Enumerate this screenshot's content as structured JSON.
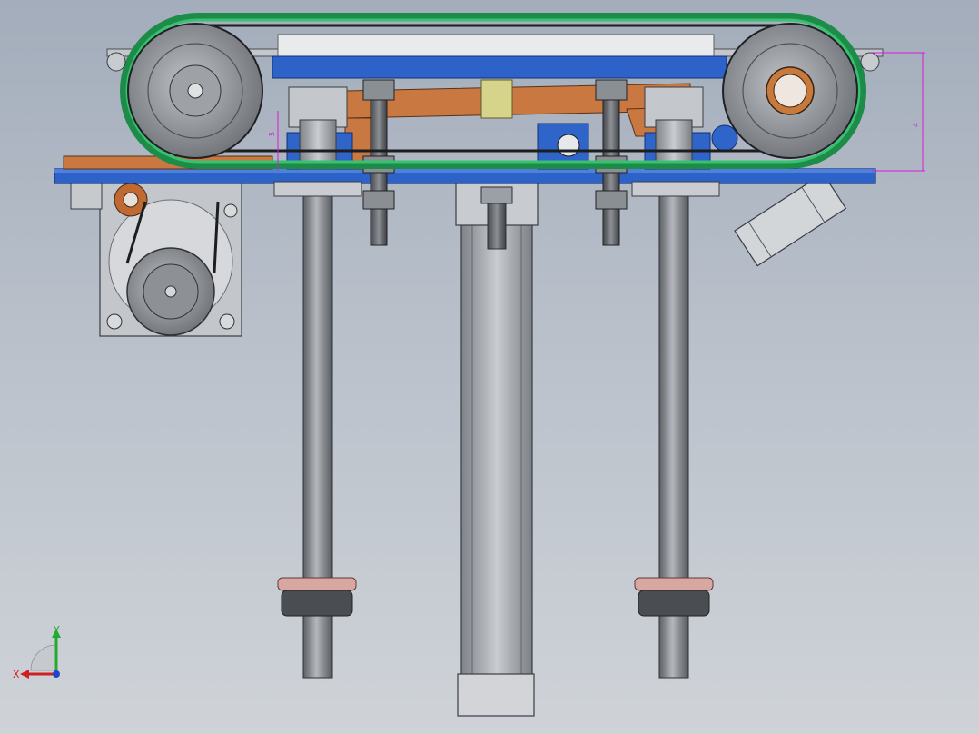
{
  "viewport": {
    "background_top": "#a3adbb",
    "background_bottom": "#cfd3d8"
  },
  "colors": {
    "belt": "#1fae5a",
    "frame_blue": "#2d63c8",
    "bracket_orange": "#c87840",
    "metal": "#9da2a8",
    "dim_magenta": "#d81ad8"
  },
  "model": {
    "parts": [
      "conveyor-belt",
      "drive-pulley-left",
      "drive-pulley-right",
      "base-plate",
      "motor-gearbox",
      "lift-cylinder",
      "guide-rod-left",
      "guide-rod-right",
      "threaded-rod-left",
      "threaded-rod-right",
      "angled-sensor-cylinder"
    ]
  },
  "dimensions": {
    "left_label": "5",
    "right_label": "4"
  },
  "triad": {
    "x_label": "X",
    "y_label": "Y",
    "x_color": "#cc2222",
    "y_color": "#22aa33",
    "z_color": "#2244cc"
  }
}
